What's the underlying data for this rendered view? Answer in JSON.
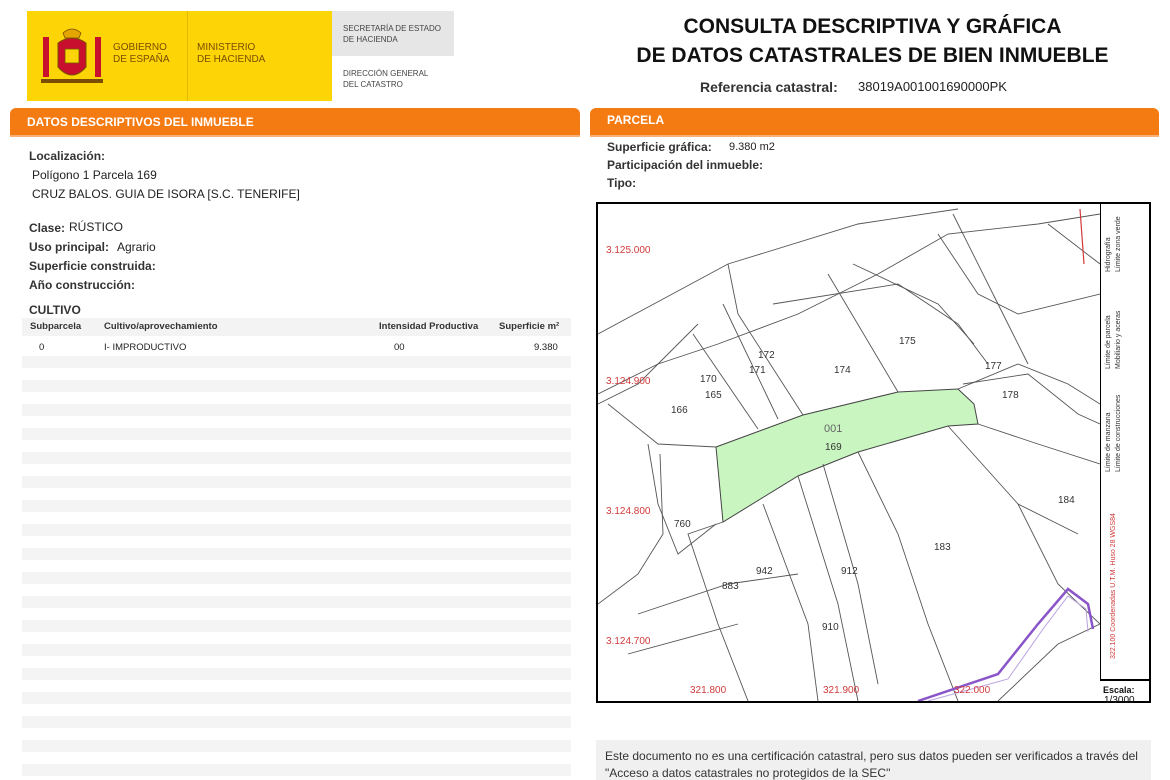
{
  "header": {
    "gobierno": [
      "GOBIERNO",
      "DE ESPAÑA"
    ],
    "ministerio": [
      "MINISTERIO",
      "DE HACIENDA"
    ],
    "secretaria": [
      "SECRETARÍA DE ESTADO",
      "DE HACIENDA"
    ],
    "direccion": [
      "DIRECCIÓN GENERAL",
      "DEL CATASTRO"
    ],
    "title_lines": [
      "CONSULTA DESCRIPTIVA Y GRÁFICA",
      "DE DATOS CATASTRALES DE BIEN INMUEBLE"
    ],
    "ref_label": "Referencia catastral:",
    "ref_value": "38019A001001690000PK",
    "colors": {
      "brand_yellow": "#fdd406",
      "accent_orange": "#f47a12"
    }
  },
  "left": {
    "section_title": "DATOS DESCRIPTIVOS DEL INMUEBLE",
    "localizacion_label": "Localización:",
    "localizacion_lines": [
      "Polígono 1 Parcela 169",
      "CRUZ BALOS. GUIA DE ISORA [S.C. TENERIFE]"
    ],
    "clase_label": "Clase:",
    "clase_value": "RÚSTICO",
    "uso_label": "Uso principal:",
    "uso_value": "Agrario",
    "superficie_label": "Superficie construida:",
    "anio_label": "Año construcción:",
    "cultivo_title": "CULTIVO",
    "table": {
      "headers": [
        "Subparcela",
        "Cultivo/aprovechamiento",
        "Intensidad Productiva",
        "Superficie m²"
      ],
      "rows": [
        [
          "0",
          "I- IMPRODUCTIVO",
          "00",
          "9.380"
        ]
      ]
    }
  },
  "right": {
    "section_title": "PARCELA",
    "superficie_label": "Superficie gráfica:",
    "superficie_value": "9.380 m2",
    "participacion_label": "Participación del inmueble:",
    "tipo_label": "Tipo:",
    "map": {
      "y_coords": [
        "3.125.000",
        "3.124.900",
        "3.124.800",
        "3.124.700"
      ],
      "x_coords": [
        "321.800",
        "321.900",
        "322.000"
      ],
      "parcel_labels": [
        "172",
        "175",
        "177",
        "174",
        "170",
        "171",
        "165",
        "166",
        "178",
        "001",
        "169",
        "184",
        "760",
        "183",
        "942",
        "912",
        "883",
        "910"
      ],
      "selected_parcel": "169",
      "legend": [
        "Límite de manzana",
        "Límite de construcciones",
        "Límite de parcela",
        "Mobiliario y aceras",
        "Hidrografía",
        "Límite zona verde",
        "322.100 Coordenadas U.T.M. Huso 28 WGS84"
      ],
      "scale_label": "Escala:",
      "scale_value": "1/3000",
      "colors": {
        "selected_fill": "#c9f5c1",
        "coord_red": "#d23a3a",
        "boundary_purple": "#8a55c8"
      }
    },
    "disclaimer": "Este documento no es una certificación catastral, pero sus datos pueden ser verificados a través del \"Acceso a datos catastrales no protegidos de la SEC\""
  }
}
